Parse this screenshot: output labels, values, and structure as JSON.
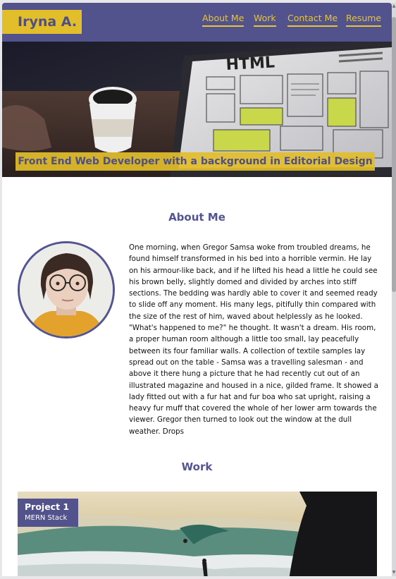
{
  "header": {
    "logo": "Iryna A.",
    "nav": [
      {
        "label": "About Me"
      },
      {
        "label": "Work"
      },
      {
        "label": "Contact Me"
      },
      {
        "label": "Resume"
      }
    ]
  },
  "hero": {
    "tagline": "Front End Web Developer with a background in Editorial Design",
    "screen_text": "HTML"
  },
  "about": {
    "title": "About Me",
    "bio": "One morning, when Gregor Samsa woke from troubled dreams, he found himself transformed in his bed into a horrible vermin. He lay on his armour-like back, and if he lifted his head a little he could see his brown belly, slightly domed and divided by arches into stiff sections. The bedding was hardly able to cover it and seemed ready to slide off any moment. His many legs, pitifully thin compared with the size of the rest of him, waved about helplessly as he looked. \"What's happened to me?\" he thought. It wasn't a dream. His room, a proper human room although a little too small, lay peacefully between its four familiar walls. A collection of textile samples lay spread out on the table - Samsa was a travelling salesman - and above it there hung a picture that he had recently cut out of an illustrated magazine and housed in a nice, gilded frame. It showed a lady fitted out with a fur hat and fur boa who sat upright, raising a heavy fur muff that covered the whole of her lower arm towards the viewer. Gregor then turned to look out the window at the dull weather. Drops"
  },
  "work": {
    "title": "Work",
    "projects": [
      {
        "name": "Project 1",
        "stack": "MERN Stack"
      }
    ]
  },
  "colors": {
    "primary": "#52528c",
    "accent": "#e2be2a",
    "background": "#ffffff"
  }
}
